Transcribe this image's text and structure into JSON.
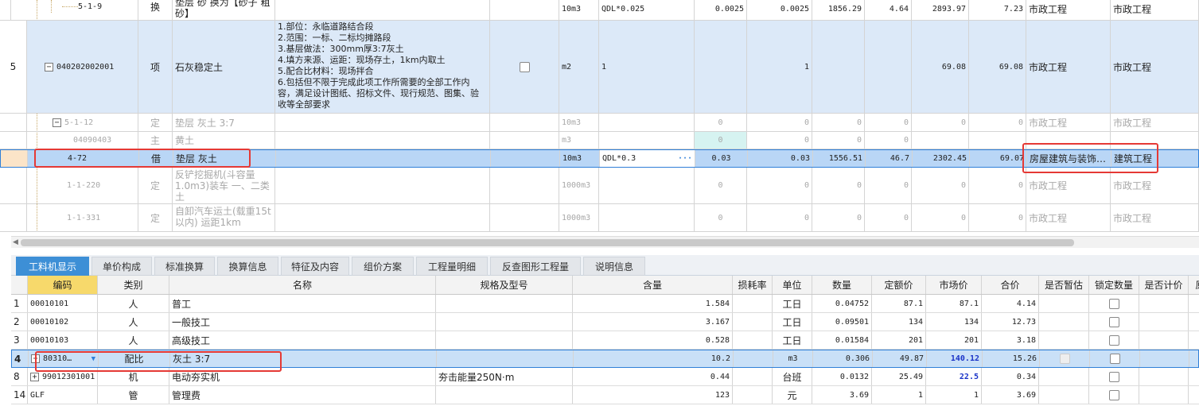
{
  "top_table": {
    "rows": [
      {
        "num": "",
        "code": "5-1-9",
        "type": "换",
        "name": "垫层 砂 换为【砂子 粗砂】",
        "feature": "",
        "unit": "10m3",
        "qty_expr": "QDL*0.025",
        "qty": "0.0025",
        "engineering_qty": "0.0025",
        "unit_price": "1856.29",
        "total_labor": "4.64",
        "composite_price": "2893.97",
        "composite_total": "7.23",
        "specialty": "市政工程",
        "pricing_specialty": "市政工程"
      },
      {
        "num": "5",
        "code": "040202002001",
        "type": "项",
        "name": "石灰稳定土",
        "feature_lines": [
          "1.部位：永临道路结合段",
          "2.范围：一标、二标均摊路段",
          "3.基层做法：300mm厚3:7灰土",
          "4.填方来源、运距：现场存土，1km内取土",
          "5.配合比材料：现场拌合",
          "6.包括但不限于完成此项工作所需要的全部工作内容，满足设计图纸、招标文件、现行规范、图集、验收等全部要求"
        ],
        "unit": "m2",
        "qty_expr": "1",
        "qty": "",
        "engineering_qty": "1",
        "unit_price": "",
        "total_labor": "",
        "composite_price": "69.08",
        "composite_total": "69.08",
        "specialty": "市政工程",
        "pricing_specialty": "市政工程"
      },
      {
        "num": "",
        "code": "5-1-12",
        "type": "定",
        "name": "垫层 灰土 3:7",
        "unit": "10m3",
        "qty_expr": "",
        "qty": "0",
        "engineering_qty": "0",
        "unit_price": "0",
        "total_labor": "0",
        "composite_price": "0",
        "composite_total": "0",
        "specialty": "市政工程",
        "pricing_specialty": "市政工程"
      },
      {
        "num": "",
        "code": "04090403",
        "type": "主",
        "name": "黄土",
        "unit": "m3",
        "qty_expr": "",
        "qty": "0",
        "engineering_qty": "0",
        "unit_price": "0",
        "total_labor": "0",
        "composite_price": "",
        "composite_total": "",
        "specialty": "",
        "pricing_specialty": ""
      },
      {
        "num": "",
        "code": "4-72",
        "type": "借",
        "name": "垫层 灰土",
        "unit": "10m3",
        "qty_expr": "QDL*0.3",
        "qty": "0.03",
        "engineering_qty": "0.03",
        "unit_price": "1556.51",
        "total_labor": "46.7",
        "composite_price": "2302.45",
        "composite_total": "69.07",
        "specialty": "房屋建筑与装饰…",
        "pricing_specialty": "建筑工程"
      },
      {
        "num": "",
        "code": "1-1-220",
        "type": "定",
        "name": "反铲挖掘机(斗容量1.0m3)装车 一、二类土",
        "unit": "1000m3",
        "qty_expr": "",
        "qty": "0",
        "engineering_qty": "0",
        "unit_price": "0",
        "total_labor": "0",
        "composite_price": "0",
        "composite_total": "0",
        "specialty": "市政工程",
        "pricing_specialty": "市政工程"
      },
      {
        "num": "",
        "code": "1-1-331",
        "type": "定",
        "name": "自卸汽车运土(载重15t以内) 运距1km",
        "unit": "1000m3",
        "qty_expr": "",
        "qty": "0",
        "engineering_qty": "0",
        "unit_price": "0",
        "total_labor": "0",
        "composite_price": "0",
        "composite_total": "0",
        "specialty": "市政工程",
        "pricing_specialty": "市政工程"
      }
    ],
    "ellipsis": "···"
  },
  "tabs": [
    "工料机显示",
    "单价构成",
    "标准换算",
    "换算信息",
    "特征及内容",
    "组价方案",
    "工程量明细",
    "反查图形工程量",
    "说明信息"
  ],
  "bottom_table": {
    "headers": [
      "编码",
      "类别",
      "名称",
      "规格及型号",
      "含量",
      "损耗率",
      "单位",
      "数量",
      "定额价",
      "市场价",
      "合价",
      "是否暂估",
      "锁定数量",
      "是否计价",
      "原"
    ],
    "rows": [
      {
        "num": "1",
        "code": "00010101",
        "cat": "人",
        "name": "普工",
        "spec": "",
        "content": "1.584",
        "loss": "",
        "unit": "工日",
        "qty": "0.04752",
        "quota_price": "87.1",
        "market_price": "87.1",
        "total": "4.14"
      },
      {
        "num": "2",
        "code": "00010102",
        "cat": "人",
        "name": "一般技工",
        "spec": "",
        "content": "3.167",
        "loss": "",
        "unit": "工日",
        "qty": "0.09501",
        "quota_price": "134",
        "market_price": "134",
        "total": "12.73"
      },
      {
        "num": "3",
        "code": "00010103",
        "cat": "人",
        "name": "高级技工",
        "spec": "",
        "content": "0.528",
        "loss": "",
        "unit": "工日",
        "qty": "0.01584",
        "quota_price": "201",
        "market_price": "201",
        "total": "3.18"
      },
      {
        "num": "4",
        "code": "80310…",
        "cat": "配比",
        "name": "灰土 3:7",
        "spec": "",
        "content": "10.2",
        "loss": "",
        "unit": "m3",
        "qty": "0.306",
        "quota_price": "49.87",
        "market_price": "140.12",
        "total": "15.26"
      },
      {
        "num": "8",
        "code": "99012301001",
        "cat": "机",
        "name": "电动夯实机",
        "spec": "夯击能量250N·m",
        "content": "0.44",
        "loss": "",
        "unit": "台班",
        "qty": "0.0132",
        "quota_price": "25.49",
        "market_price": "22.5",
        "total": "0.34"
      },
      {
        "num": "14",
        "code": "GLF",
        "cat": "管",
        "name": "管理费",
        "spec": "",
        "content": "123",
        "loss": "",
        "unit": "元",
        "qty": "3.69",
        "quota_price": "1",
        "market_price": "1",
        "total": "3.69"
      }
    ]
  },
  "colors": {
    "accent": "#3d8fd6",
    "highlight_row": "#b9d6f6",
    "item_row": "#dce9f8",
    "red_box": "#e53935",
    "blue_price": "#1a33c8"
  }
}
